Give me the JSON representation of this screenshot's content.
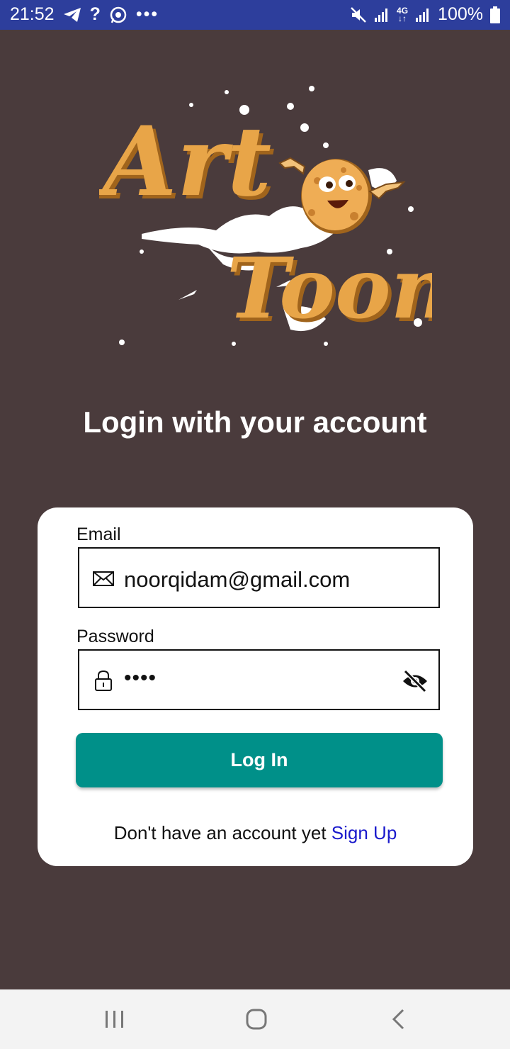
{
  "status_bar": {
    "time": "21:52",
    "battery": "100%",
    "icons": [
      "telegram-icon",
      "question-icon",
      "whatsapp-icon",
      "more-icon",
      "mute-icon",
      "signal-icon",
      "network-4g-icon",
      "signal-icon",
      "battery-icon"
    ]
  },
  "logo": {
    "line1": "Art",
    "line2": "Toon",
    "colors": {
      "gold": "#e8a548",
      "shadow": "#a0641c"
    }
  },
  "heading": "Login with your account",
  "form": {
    "email_label": "Email",
    "email_value": "noorqidam@gmail.com",
    "password_label": "Password",
    "password_value": "••••",
    "login_label": "Log In",
    "signup_prompt": "Don't have an account yet",
    "signup_link": "Sign Up"
  },
  "colors": {
    "background": "#4a3b3c",
    "status_bar": "#2d3e9c",
    "button": "#009089",
    "link": "#1a1acc"
  },
  "nav": {
    "icons": [
      "recents-icon",
      "home-icon",
      "back-icon"
    ]
  }
}
